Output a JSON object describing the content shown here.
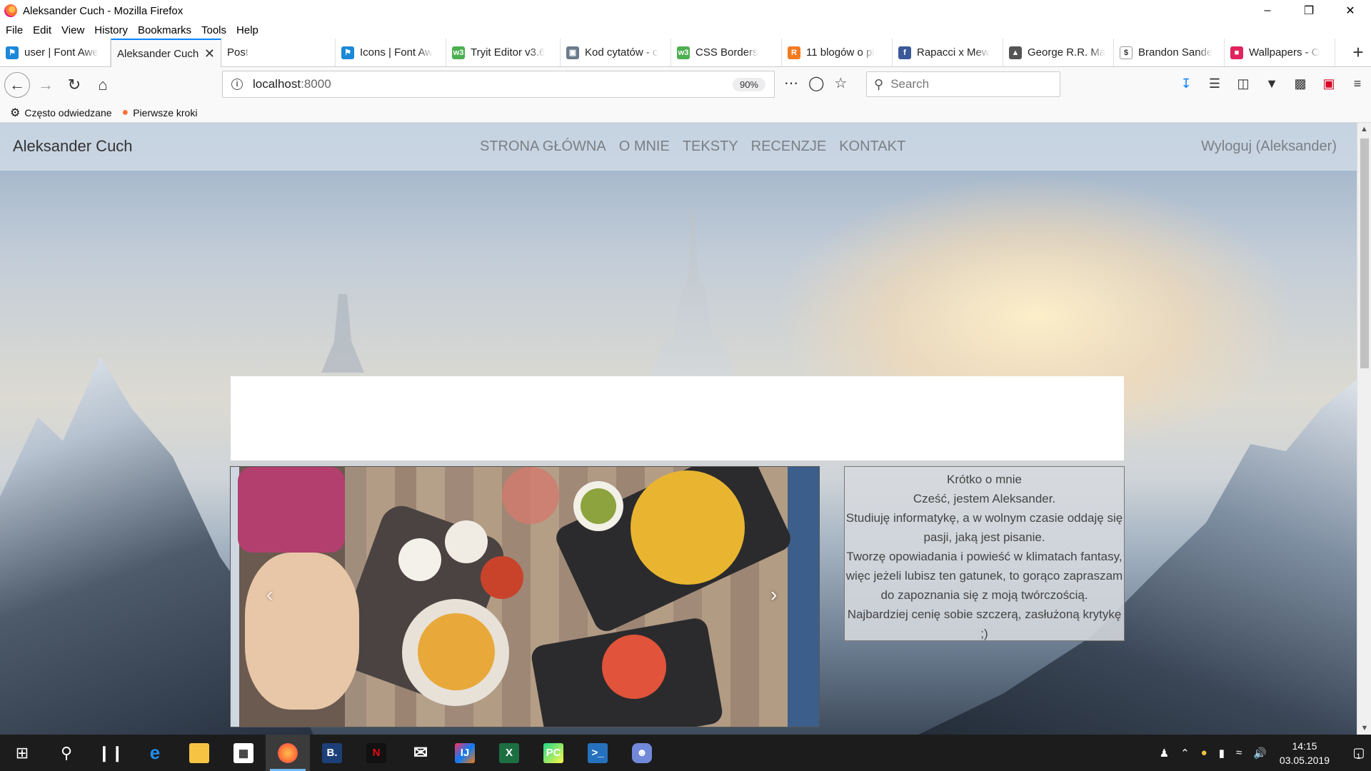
{
  "window": {
    "title": "Aleksander Cuch - Mozilla Firefox"
  },
  "menu": [
    "File",
    "Edit",
    "View",
    "History",
    "Bookmarks",
    "Tools",
    "Help"
  ],
  "tabs": [
    {
      "label": "user | Font Awe",
      "icon": "font-awesome-icon",
      "color": "#1c88d8"
    },
    {
      "label": "Aleksander Cuch",
      "icon": "",
      "color": "",
      "active": true
    },
    {
      "label": "Post",
      "icon": "",
      "color": ""
    },
    {
      "label": "Icons | Font Aw",
      "icon": "font-awesome-icon",
      "color": "#1c88d8"
    },
    {
      "label": "Tryit Editor v3.6",
      "icon": "w3schools-icon",
      "color": "#4caf50"
    },
    {
      "label": "Kod cytatów - c",
      "icon": "page-icon",
      "color": "#6b7b8c"
    },
    {
      "label": "CSS Borders",
      "icon": "w3schools-icon",
      "color": "#4caf50"
    },
    {
      "label": "11 blogów o pi",
      "icon": "blog-icon",
      "color": "#f47b20"
    },
    {
      "label": "Rapacci x Mew",
      "icon": "facebook-icon",
      "color": "#3b5998"
    },
    {
      "label": "George R.R. Ma",
      "icon": "image-icon",
      "color": "#555555"
    },
    {
      "label": "Brandon Sande",
      "icon": "dollar-icon",
      "color": "#333333"
    },
    {
      "label": "Wallpapers - O",
      "icon": "wallpapers-icon",
      "color": "#e0245e"
    }
  ],
  "nav": {
    "url_host": "localhost",
    "url_port": ":8000",
    "zoom": "90%",
    "search_placeholder": "Search"
  },
  "bookmarks": [
    {
      "label": "Często odwiedzane",
      "icon": "gear-icon"
    },
    {
      "label": "Pierwsze kroki",
      "icon": "firefox-icon"
    }
  ],
  "site": {
    "brand": "Aleksander Cuch",
    "nav": [
      "STRONA GŁÓWNA",
      "O MNIE",
      "TEKSTY",
      "RECENZJE",
      "KONTAKT"
    ],
    "logout": "Wyloguj (Aleksander)",
    "carousel_prev": "‹",
    "carousel_next": "›",
    "about": {
      "heading": "Krótko o mnie",
      "lines": [
        "Cześć, jestem Aleksander.",
        "Studiuję informatykę, a w wolnym czasie oddaję się pasji, jaką jest pisanie.",
        "Tworzę opowiadania i powieść w klimatach fantasy, więc jeżeli lubisz ten gatunek, to gorąco zapraszam do zapoznania się z moją twórczością.",
        "Najbardziej cenię sobie szczerą, zasłużoną krytykę ;)"
      ]
    }
  },
  "taskbar": {
    "time": "14:15",
    "date": "03.05.2019",
    "notifications": "1"
  }
}
